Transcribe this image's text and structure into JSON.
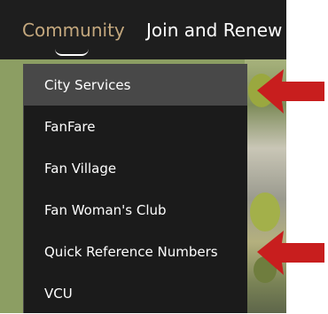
{
  "nav": {
    "community_label": "Community",
    "join_label": "Join and Renew"
  },
  "dropdown": {
    "items": [
      {
        "label": "City Services",
        "active": true
      },
      {
        "label": "FanFare"
      },
      {
        "label": "Fan Village"
      },
      {
        "label": "Fan Woman's Club"
      },
      {
        "label": "Quick Reference Numbers"
      },
      {
        "label": "VCU"
      }
    ]
  },
  "annotations": {
    "arrows": [
      {
        "icon": "red-arrow-icon",
        "points_to": "City Services"
      },
      {
        "icon": "red-arrow-icon",
        "points_to": "Quick Reference Numbers"
      }
    ],
    "arrow_color": "#c81e1e"
  },
  "colors": {
    "nav_background": "#1e1e1e",
    "active_nav_text": "#c4a87e",
    "dropdown_background": "#1b1b1b",
    "active_item_background": "#484848",
    "backdrop_green": "#8c9e63"
  }
}
